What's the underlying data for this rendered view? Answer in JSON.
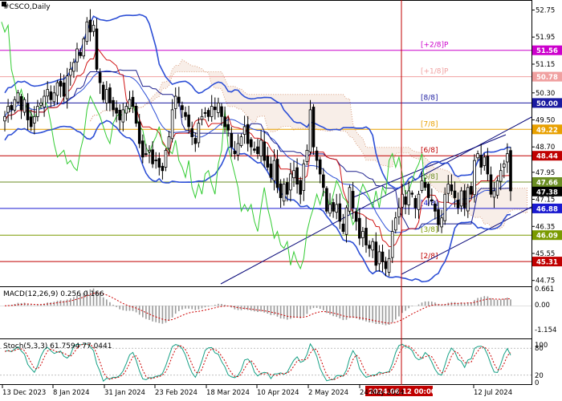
{
  "symbol_title": "#CSCO,Daily",
  "macd_title": "MACD(12,26,9) 0.256 0.166",
  "stoch_title": "Stoch(5,3,3) 61.7594 77.0441",
  "colors": {
    "bg": "#ffffff",
    "candle": "#000000",
    "bb": "#2d4fd6",
    "tenkan": "#d11515",
    "kijun": "#1b1e8c",
    "chikou": "#33cc33",
    "cloud": "#d9a080",
    "channel": "#0a0a7a",
    "crosshair": "#c00000",
    "macd_hist": "#9a9a9a",
    "macd_signal": "#cc0000",
    "stoch_main": "#16a085",
    "stoch_signal": "#cc0000"
  },
  "chart_data": [
    {
      "type": "candlestick",
      "title": "#CSCO,Daily",
      "ylim": [
        44.6,
        53.0
      ],
      "price_ticks": [
        "52.75",
        "51.95",
        "51.15",
        "50.30",
        "49.50",
        "48.70",
        "47.95",
        "47.15",
        "46.35",
        "45.55",
        "44.75"
      ],
      "date_labels": [
        "13 Dec 2023",
        "8 Jan 2024",
        "31 Jan 2024",
        "23 Feb 2024",
        "18 Mar 2024",
        "10 Apr 2024",
        "2 May 2024",
        "24 May 2024",
        "12 Jul 2024"
      ],
      "crosshair_label": "2024.06.12 00:00",
      "levels": [
        {
          "label": "[+2/8]P",
          "value": 51.56,
          "tag": "51.56",
          "color": "#cc00cc",
          "style": "solid"
        },
        {
          "label": "[+1/8]P",
          "value": 50.78,
          "tag": "50.78",
          "color": "#f0a0a0",
          "style": "solid"
        },
        {
          "label": "[8/8]",
          "value": 50.0,
          "tag": "50.00",
          "color": "#1a1aa0",
          "style": "solid"
        },
        {
          "label": "[7/8]",
          "value": 49.22,
          "tag": "49.22",
          "color": "#e8a000",
          "style": "solid"
        },
        {
          "label": "[6/8]",
          "value": 48.44,
          "tag": "48.44",
          "color": "#c00000",
          "style": "solid"
        },
        {
          "label": "[5/8]",
          "value": 47.66,
          "tag": "47.66",
          "color": "#6b8e23",
          "style": "solid"
        },
        {
          "label": "",
          "value": 47.38,
          "tag": "47.38",
          "color": "#000000",
          "style": "none"
        },
        {
          "label": "[4/8]",
          "value": 46.88,
          "tag": "46.88",
          "color": "#1a1ad0",
          "style": "solid"
        },
        {
          "label": "[3/8]",
          "value": 46.09,
          "tag": "46.09",
          "color": "#7a9a00",
          "style": "solid"
        },
        {
          "label": "[2/8]",
          "value": 45.31,
          "tag": "45.31",
          "color": "#c00000",
          "style": "solid"
        }
      ],
      "closes": [
        49.6,
        49.9,
        49.8,
        50.1,
        50.3,
        49.8,
        50.1,
        49.5,
        49.3,
        49.6,
        49.9,
        50.0,
        50.2,
        50.4,
        50.1,
        50.3,
        50.6,
        50.5,
        50.2,
        50.8,
        51.0,
        51.2,
        51.6,
        51.4,
        51.9,
        52.4,
        52.1,
        52.3,
        51.0,
        50.6,
        50.1,
        50.4,
        50.0,
        49.8,
        49.7,
        49.5,
        49.8,
        49.9,
        50.1,
        49.9,
        49.4,
        48.8,
        48.4,
        48.5,
        48.6,
        48.2,
        48.3,
        48.1,
        48.0,
        48.6,
        49.0,
        49.8,
        50.2,
        50.0,
        49.8,
        49.6,
        49.3,
        49.0,
        48.8,
        49.4,
        49.6,
        49.7,
        49.6,
        49.9,
        49.8,
        50.0,
        49.6,
        49.3,
        49.2,
        48.7,
        48.5,
        48.8,
        49.0,
        49.3,
        48.8,
        48.7,
        48.6,
        48.5,
        48.9,
        48.3,
        48.1,
        47.8,
        48.3,
        47.5,
        47.2,
        47.6,
        47.3,
        47.9,
        48.0,
        47.6,
        47.3,
        48.2,
        48.6,
        49.8,
        48.7,
        48.3,
        47.9,
        47.5,
        46.8,
        47.0,
        46.8,
        47.0,
        46.5,
        46.2,
        46.9,
        47.5,
        46.9,
        46.5,
        46.0,
        46.2,
        45.8,
        45.7,
        45.9,
        45.2,
        45.6,
        45.3,
        45.1,
        45.4,
        46.2,
        46.6,
        46.9,
        47.3,
        47.0,
        47.4,
        47.3,
        46.9,
        47.3,
        47.7,
        47.5,
        47.2,
        47.1,
        46.8,
        46.4,
        46.6,
        47.3,
        47.6,
        47.4,
        47.2,
        46.9,
        47.4,
        46.9,
        47.5,
        47.3,
        48.3,
        48.5,
        48.1,
        48.4,
        47.9,
        47.3,
        47.4,
        47.7,
        48.0,
        48.2,
        48.5,
        47.4
      ]
    },
    {
      "type": "line",
      "title": "MACD(12,26,9) 0.256 0.166",
      "ylim": [
        -1.154,
        0.661
      ],
      "tick_labels": [
        "0.661",
        "0.00",
        "-1.154"
      ]
    },
    {
      "type": "line",
      "title": "Stoch(5,3,3) 61.7594 77.0441",
      "ylim": [
        0,
        100
      ],
      "tick_labels": [
        "100",
        "80",
        "20",
        "0"
      ]
    }
  ]
}
